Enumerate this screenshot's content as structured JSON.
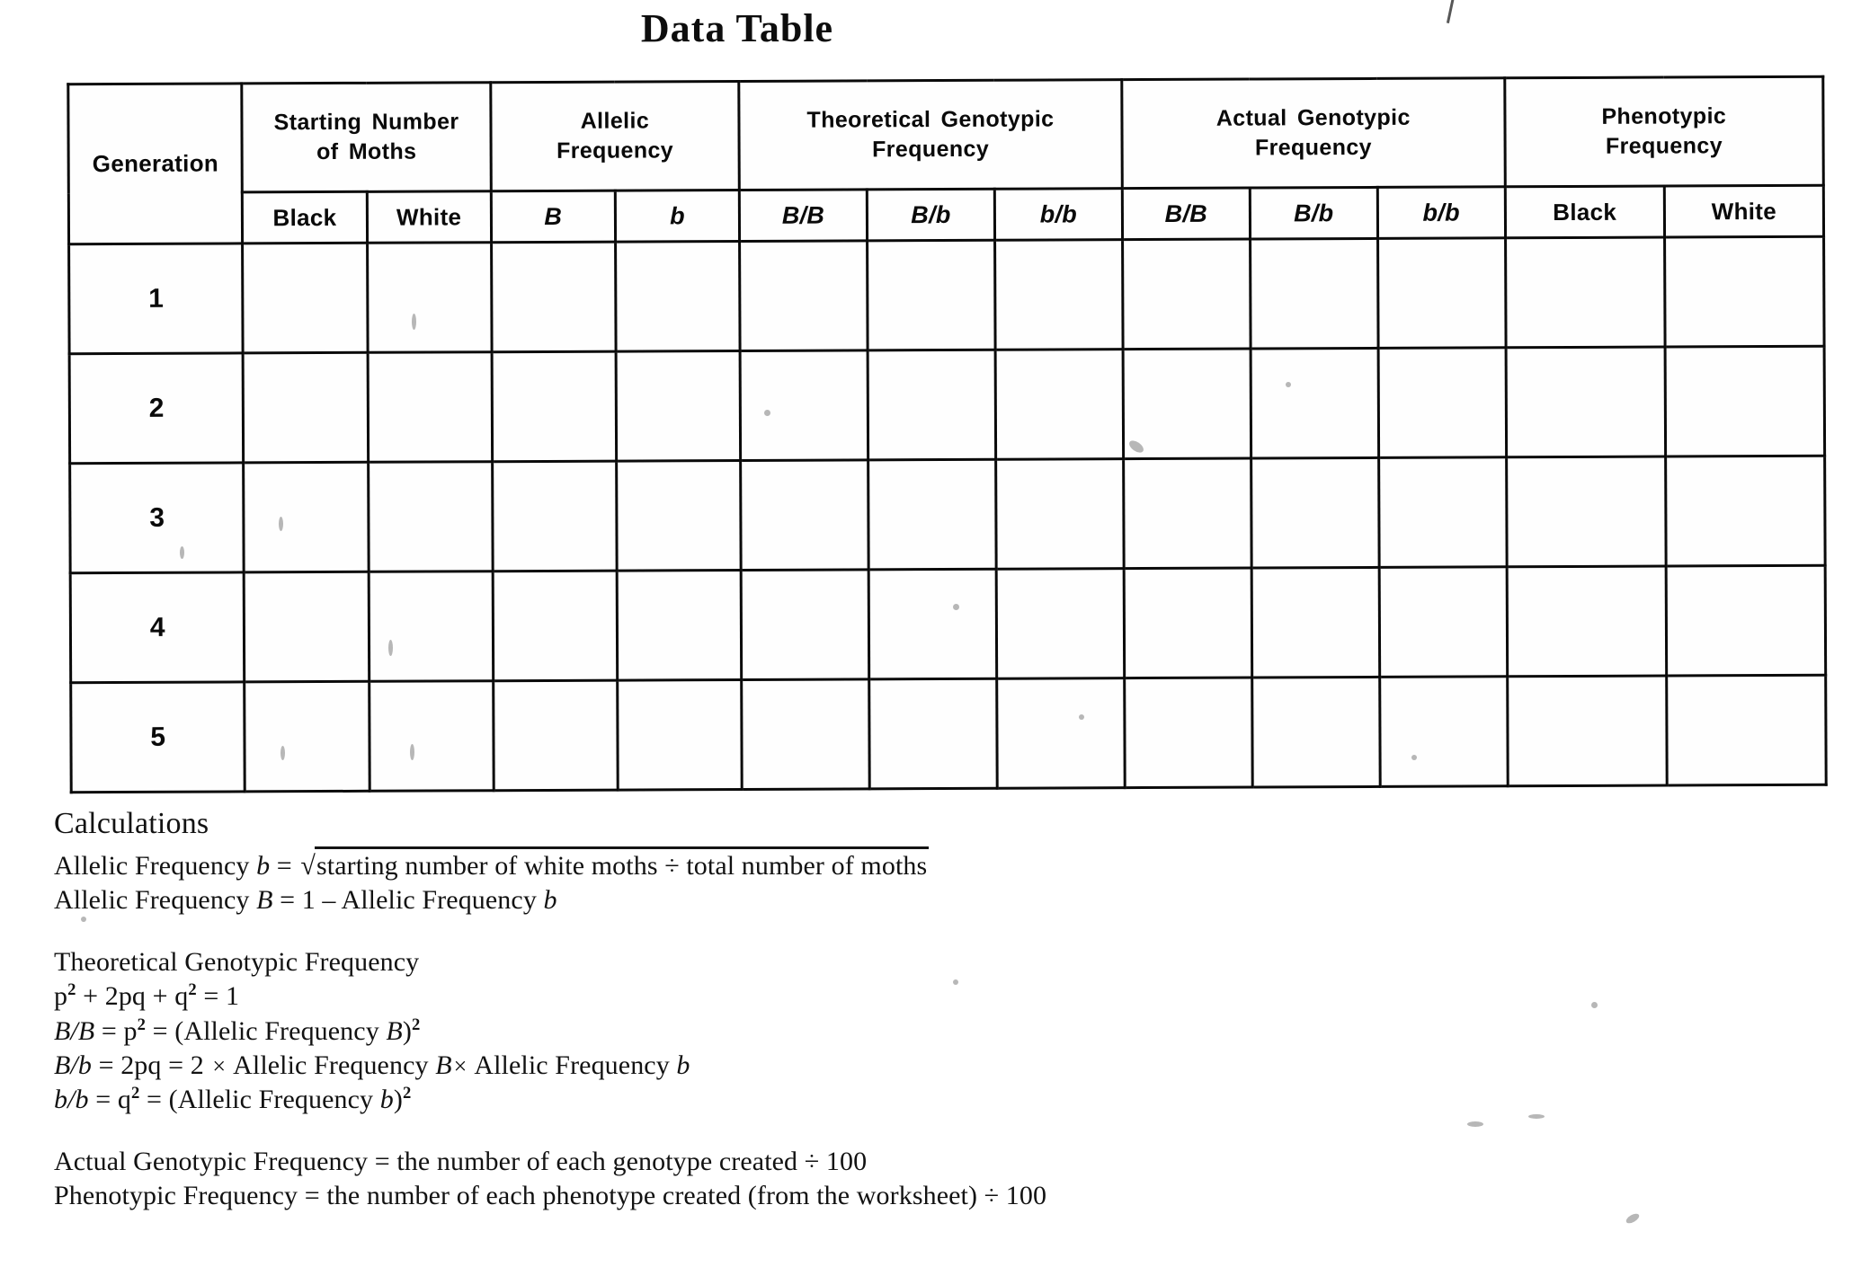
{
  "document": {
    "title": "Data Table"
  },
  "table": {
    "group_headers": [
      {
        "label": "Generation",
        "span": 1,
        "rowspan": 2
      },
      {
        "label": "Starting  Number\nof Moths",
        "line1": "Starting  Number",
        "line2": "of Moths",
        "span": 2
      },
      {
        "label": "Allelic\nFrequency",
        "line1": "Allelic",
        "line2": "Frequency",
        "span": 2
      },
      {
        "label": "Theoretical  Genotypic\nFrequency",
        "line1": "Theoretical  Genotypic",
        "line2": "Frequency",
        "span": 3
      },
      {
        "label": "Actual  Genotypic\nFrequency",
        "line1": "Actual  Genotypic",
        "line2": "Frequency",
        "span": 3
      },
      {
        "label": "Phenotypic\nFrequency",
        "line1": "Phenotypic",
        "line2": "Frequency",
        "span": 2
      }
    ],
    "sub_headers": [
      {
        "label": "Black",
        "italic": false
      },
      {
        "label": "White",
        "italic": false
      },
      {
        "label": "B",
        "italic": true
      },
      {
        "label": "b",
        "italic": true
      },
      {
        "label": "B/B",
        "italic": true
      },
      {
        "label": "B/b",
        "italic": true
      },
      {
        "label": "b/b",
        "italic": true
      },
      {
        "label": "B/B",
        "italic": true
      },
      {
        "label": "B/b",
        "italic": true
      },
      {
        "label": "b/b",
        "italic": true
      },
      {
        "label": "Black",
        "italic": false
      },
      {
        "label": "White",
        "italic": false
      }
    ],
    "rows": [
      {
        "generation": "1",
        "cells": [
          "",
          "",
          "",
          "",
          "",
          "",
          "",
          "",
          "",
          "",
          "",
          ""
        ]
      },
      {
        "generation": "2",
        "cells": [
          "",
          "",
          "",
          "",
          "",
          "",
          "",
          "",
          "",
          "",
          "",
          ""
        ]
      },
      {
        "generation": "3",
        "cells": [
          "",
          "",
          "",
          "",
          "",
          "",
          "",
          "",
          "",
          "",
          "",
          ""
        ]
      },
      {
        "generation": "4",
        "cells": [
          "",
          "",
          "",
          "",
          "",
          "",
          "",
          "",
          "",
          "",
          "",
          ""
        ]
      },
      {
        "generation": "5",
        "cells": [
          "",
          "",
          "",
          "",
          "",
          "",
          "",
          "",
          "",
          "",
          "",
          ""
        ]
      }
    ]
  },
  "calculations": {
    "heading": "Calculations",
    "allelic_b_prefix": "Allelic Frequency ",
    "allelic_b_var": "b",
    "allelic_b_eq": " = ",
    "radical_sign": "√",
    "allelic_b_radicand": "starting number of white moths ÷ total number of moths",
    "allelic_B_prefix": "Allelic Frequency ",
    "allelic_B_var": "B",
    "allelic_B_rest": " = 1 – Allelic Frequency ",
    "allelic_B_rest_var": "b",
    "theoretical_heading": "Theoretical Genotypic Frequency",
    "hardy_weinberg_p": "p",
    "hardy_weinberg_rest": " + 2pq + q",
    "hardy_weinberg_end": " = 1",
    "sup2": "2",
    "bb_line": {
      "var": "B/B",
      "mid": " = p",
      "sup": "2",
      "tail": " = (Allelic Frequency ",
      "tail_var": "B",
      "tail_end": ")",
      "tail_sup": "2"
    },
    "bbhet_line": {
      "var": "B/b",
      "mid": " = 2pq = 2 ",
      "times": "×",
      "tail": " Allelic Frequency ",
      "tail_var": "B",
      "times2": "×",
      "tail2": " Allelic Frequency ",
      "tail_var2": "b"
    },
    "bbrec_line": {
      "var": "b/b",
      "mid": " = q",
      "sup": "2",
      "tail": " = (Allelic Frequency ",
      "tail_var": "b",
      "tail_end": ")",
      "tail_sup": "2"
    },
    "actual_line": "Actual Genotypic Frequency = the number of each genotype created ÷ 100",
    "phenotypic_line": "Phenotypic Frequency = the number of each phenotype created (from the worksheet) ÷ 100"
  },
  "colors": {
    "ink": "#0a0a0a",
    "paper": "#ffffff",
    "border": "#0a0a0a"
  }
}
